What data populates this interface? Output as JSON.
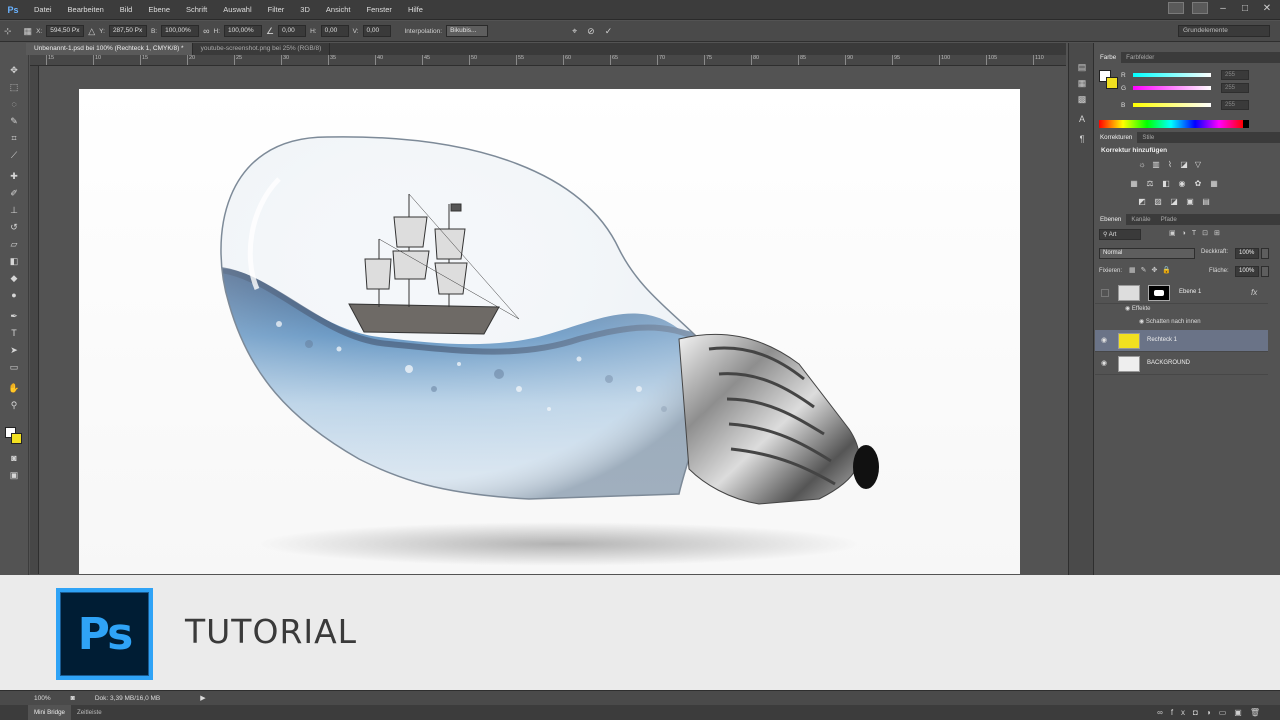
{
  "app": {
    "logo": "Ps"
  },
  "menu": [
    "Datei",
    "Bearbeiten",
    "Bild",
    "Ebene",
    "Schrift",
    "Auswahl",
    "Filter",
    "3D",
    "Ansicht",
    "Fenster",
    "Hilfe"
  ],
  "options": {
    "x_label": "X:",
    "x_value": "594,50 Px",
    "y_label": "Y:",
    "y_value": "287,50 Px",
    "b_label": "B:",
    "b_value": "100,00%",
    "h_label": "H:",
    "h_value": "100,00%",
    "angle_value": "0,00",
    "hs_label": "H:",
    "hs_value": "0,00",
    "v_label": "V:",
    "v_value": "0,00",
    "interp_label": "Interpolation:",
    "interp_value": "Bikubis...",
    "workspace": "Grundelemente"
  },
  "tabs": [
    {
      "label": "Unbenannt-1.psd bei 100% (Rechteck 1, CMYK/8) *"
    },
    {
      "label": "youtube-screenshot.png bei 25% (RGB/8)"
    }
  ],
  "ruler_ticks": [
    "15",
    "10",
    "15",
    "20",
    "25",
    "30",
    "35",
    "40",
    "45",
    "50",
    "55",
    "60",
    "65",
    "70",
    "75",
    "80",
    "85",
    "90",
    "95",
    "100",
    "105",
    "110"
  ],
  "color_panel": {
    "tabs": [
      "Farbe",
      "Farbfelder"
    ],
    "r_label": "R",
    "g_label": "G",
    "b_label": "B",
    "r_value": "255",
    "g_value": "255",
    "b_value": "255"
  },
  "adjust_panel": {
    "tabs": [
      "Korrekturen",
      "Stile"
    ],
    "heading": "Korrektur hinzufügen"
  },
  "layers_panel": {
    "tabs": [
      "Ebenen",
      "Kanäle",
      "Pfade"
    ],
    "filter": "Art",
    "blend": "Normal",
    "opacity_label": "Deckkraft:",
    "opacity_value": "100%",
    "lock_label": "Fixieren:",
    "fill_label": "Fläche:",
    "fill_value": "100%",
    "layers": [
      {
        "name": "Ebene 1"
      },
      {
        "name": "Effekte"
      },
      {
        "name": "Schatten nach innen"
      },
      {
        "name": "Rechteck 1"
      },
      {
        "name": "BACKGROUND"
      }
    ]
  },
  "status": {
    "zoom": "100%",
    "doc": "Dok: 3,39 MB/16,0 MB"
  },
  "bottom_tabs": [
    "Mini Bridge",
    "Zeitleiste"
  ],
  "banner": {
    "logo": "Ps",
    "title": "TUTORIAL"
  },
  "colors": {
    "accent_blue": "#2fa3f6",
    "fg_swatch": "#ffffff",
    "bg_swatch": "#f2e020",
    "layer_selected": "#6a7387"
  }
}
